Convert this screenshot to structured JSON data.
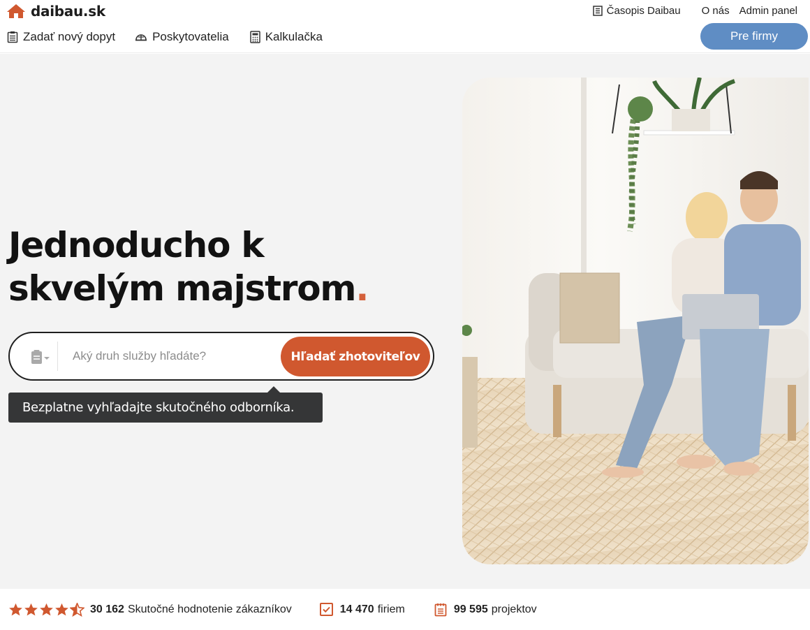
{
  "brand": {
    "name": "daibau.sk",
    "accent": "#d0582f",
    "blue": "#5f8dc4"
  },
  "top_links": {
    "magazine": "Časopis Daibau",
    "about": "O nás",
    "admin": "Admin panel"
  },
  "nav": {
    "new_request": "Zadať nový dopyt",
    "providers": "Poskytovatelia",
    "calculator": "Kalkulačka"
  },
  "cta_firms": "Pre firmy",
  "hero": {
    "headline_line1": "Jednoducho k",
    "headline_line2": "skvelým majstrom",
    "headline_dot": ".",
    "search_placeholder": "Aký druh služby hľadáte?",
    "search_button": "Hľadať zhotoviteľov",
    "tooltip": "Bezplatne vyhľadajte skutočného odborníka.",
    "photo_icon": "couple-on-sofa-with-laptop"
  },
  "stats": {
    "rating_stars": 4.5,
    "reviews_count": "30 162",
    "reviews_label": "Skutočné hodnotenie zákazníkov",
    "companies_count": "14 470",
    "companies_label": "firiem",
    "projects_count": "99 595",
    "projects_label": "projektov"
  }
}
